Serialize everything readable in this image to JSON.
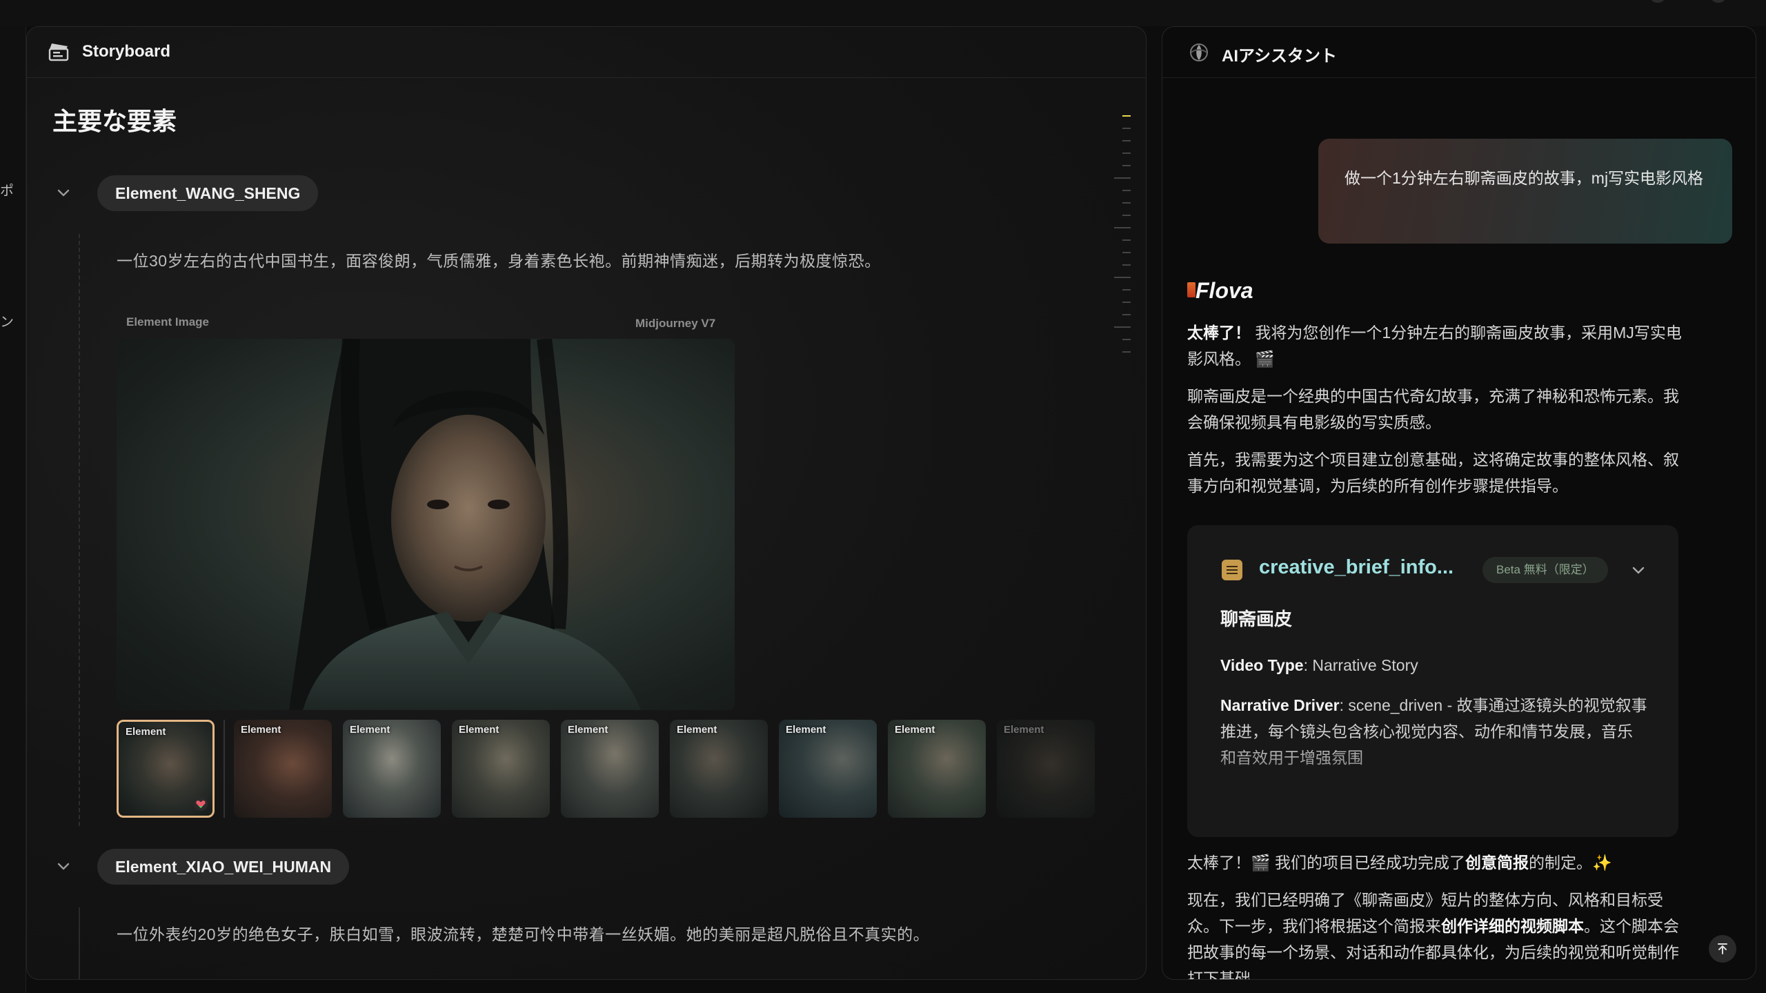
{
  "storyboard": {
    "title": "Storyboard",
    "section_title": "主要な要素",
    "elements": [
      {
        "name": "Element_WANG_SHENG",
        "description": "一位30岁左右的古代中国书生，面容俊朗，气质儒雅，身着素色长袍。前期神情痴迷，后期转为极度惊恐。",
        "image_label": "Element Image",
        "model_label": "Midjourney V7",
        "thumbnail_label": "Element"
      },
      {
        "name": "Element_XIAO_WEI_HUMAN",
        "description": "一位外表约20岁的绝色女子，肤白如雪，眼波流转，楚楚可怜中带着一丝妖媚。她的美丽是超凡脱俗且不真实的。"
      }
    ],
    "thumbnails": [
      "Element",
      "Element",
      "Element",
      "Element",
      "Element",
      "Element",
      "Element",
      "Element",
      "Element"
    ],
    "left_rail": {
      "glyph_top": "ポ",
      "glyph_bottom": "ン"
    }
  },
  "assistant": {
    "title": "AIアシスタント",
    "user_message": "做一个1分钟左右聊斋画皮的故事，mj写实电影风格",
    "brand": "Flova",
    "messages": {
      "m1_bold": "太棒了！",
      "m1_rest": "我将为您创作一个1分钟左右的聊斋画皮故事，采用MJ写实电影风格。",
      "m1_emoji": "🎬",
      "m2": "聊斋画皮是一个经典的中国古代奇幻故事，充满了神秘和恐怖元素。我会确保视频具有电影级的写实质感。",
      "m3": "首先，我需要为这个项目建立创意基础，这将确定故事的整体风格、叙事方向和视觉基调，为后续的所有创作步骤提供指导。",
      "m4_pre": "太棒了！🎬 我们的项目已经成功完成了",
      "m4_bold": "创意简报",
      "m4_post": "的制定。✨",
      "m5_pre": "现在，我们已经明确了《聊斋画皮》短片的整体方向、风格和目标受众。下一步，我们将根据这个简报来",
      "m5_bold": "创作详细的视频脚本",
      "m5_post": "。这个脚本会把故事的每一个场景、对话和动作都具体化，为后续的视觉和听觉制作打下基础。"
    },
    "tool_card": {
      "name": "creative_brief_info...",
      "badge": "Beta 無料（限定）",
      "heading": "聊斋画皮",
      "video_type_label": "Video Type",
      "video_type_value": ": Narrative Story",
      "narrative_driver_label": "Narrative Driver",
      "narrative_driver_value": ": scene_driven - 故事通过逐镜头的视觉叙事推进，每个镜头包含核心视觉内容、动作和情节发展，音乐和音效用于增强氛围"
    }
  },
  "colors": {
    "accent_tick": "#e8d84a",
    "selected_thumb_border": "#e3b684",
    "tool_name": "#9fe0e0"
  }
}
